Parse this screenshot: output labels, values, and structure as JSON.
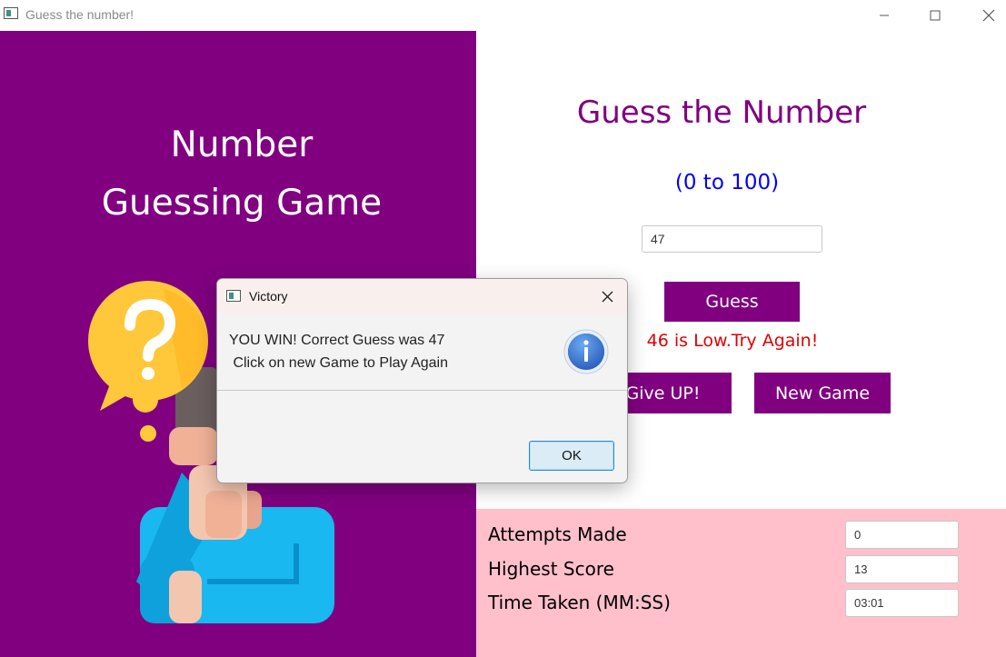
{
  "window": {
    "title": "Guess the number!",
    "controls": {
      "minimize": "—",
      "maximize": "☐",
      "close": "✕"
    }
  },
  "left_panel": {
    "title_line1": "Number",
    "title_line2": "Guessing Game",
    "bg_color": "#800080",
    "illustration": "person-thinking-with-question-mark"
  },
  "game": {
    "title": "Guess the Number",
    "range": "(0 to 100)",
    "guess_value": "47",
    "guess_button": "Guess",
    "hint": "46 is Low.Try Again!",
    "give_up_button": "Give UP!",
    "new_game_button": "New Game",
    "title_color": "#800080",
    "range_color": "#0000ff",
    "hint_color": "#e00000"
  },
  "stats": {
    "attempts_label": "Attempts Made",
    "attempts_value": "0",
    "highest_label": "Highest Score",
    "highest_value": "13",
    "time_label": "Time Taken (MM:SS)",
    "time_value": "03:01",
    "bg_color": "#ffc0cb"
  },
  "dialog": {
    "title": "Victory",
    "message_line1": "YOU WIN! Correct Guess was 47",
    "message_line2": " Click on new Game to Play Again",
    "icon": "info-icon",
    "ok_button": "OK"
  }
}
